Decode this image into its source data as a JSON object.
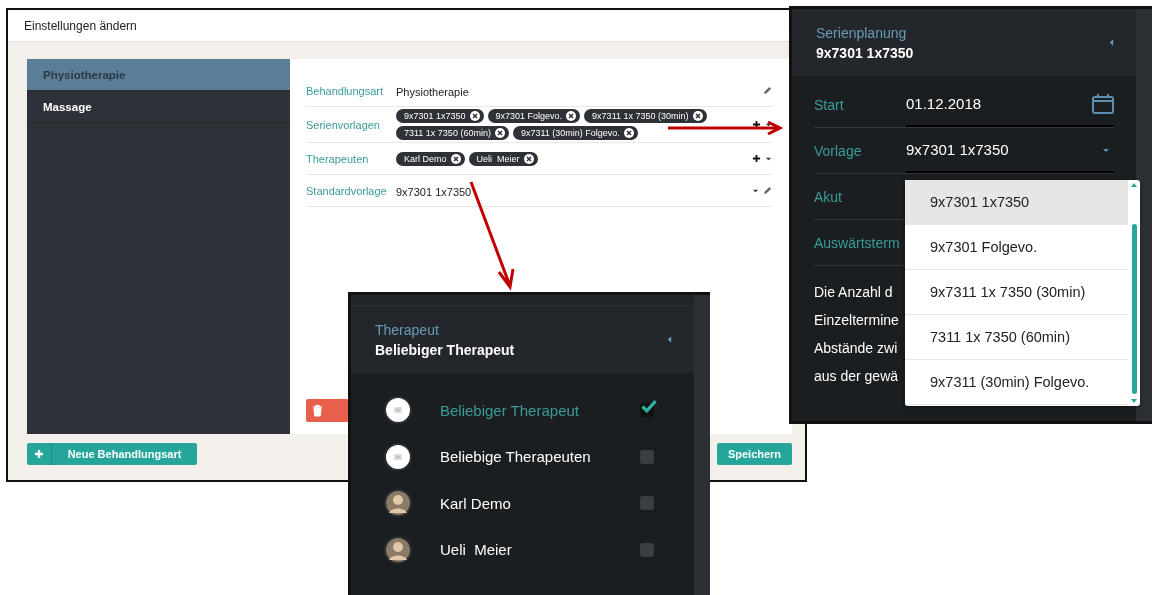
{
  "dialog": {
    "title": "Einstellungen ändern",
    "sidebar": [
      {
        "label": "Physiotherapie",
        "selected": true
      },
      {
        "label": "Massage",
        "selected": false
      }
    ],
    "fields": [
      {
        "label": "Behandlungsart",
        "kind": "text",
        "value": "Physiotherapie"
      },
      {
        "label": "Serienvorlagen",
        "kind": "chips",
        "chips": [
          "9x7301 1x7350",
          "9x7301 Folgevo.",
          "9x7311 1x 7350 (30min)",
          "7311 1x 7350 (60min)",
          "9x7311 (30min) Folgevo."
        ]
      },
      {
        "label": "Therapeuten",
        "kind": "chips",
        "chips": [
          "Karl Demo",
          "Ueli  Meier"
        ]
      },
      {
        "label": "Standardvorlage",
        "kind": "select",
        "value": "9x7301 1x7350"
      }
    ],
    "new_button": "Neue Behandlungsart",
    "save_button": "Speichern"
  },
  "series_panel": {
    "title": "Serienplanung",
    "subtitle": "9x7301 1x7350",
    "fields": [
      {
        "label": "Start",
        "kind": "date",
        "value": "01.12.2018"
      },
      {
        "label": "Vorlage",
        "kind": "select",
        "value": "9x7301 1x7350"
      },
      {
        "label": "Akut",
        "kind": "plain"
      },
      {
        "label": "Auswärtsterm",
        "kind": "plain"
      }
    ],
    "description_lines": [
      "Die Anzahl d",
      "Einzeltermine",
      "Abstände zwi",
      "aus der gewä"
    ],
    "dropdown": [
      {
        "label": "9x7301 1x7350",
        "selected": true
      },
      {
        "label": "9x7301 Folgevo.",
        "selected": false
      },
      {
        "label": "9x7311 1x 7350 (30min)",
        "selected": false
      },
      {
        "label": "7311 1x 7350 (60min)",
        "selected": false
      },
      {
        "label": "9x7311 (30min) Folgevo.",
        "selected": false
      }
    ]
  },
  "therapist_panel": {
    "title": "Therapeut",
    "subtitle": "Beliebiger Therapeut",
    "options": [
      {
        "label": "Beliebiger Therapeut",
        "kind": "placeholder",
        "selected": true,
        "checked": true
      },
      {
        "label": "Beliebige Therapeuten",
        "kind": "placeholder",
        "selected": false,
        "checked": false
      },
      {
        "label": "Karl Demo",
        "kind": "photo",
        "selected": false,
        "checked": false
      },
      {
        "label": "Ueli  Meier",
        "kind": "photo",
        "selected": false,
        "checked": false
      }
    ]
  }
}
